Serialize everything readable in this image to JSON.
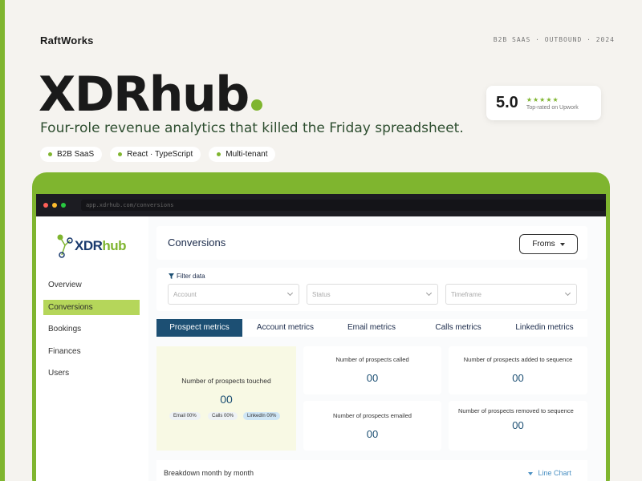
{
  "brand": "RaftWorks",
  "meta": "B2B SAAS · OUTBOUND · 2024",
  "hero": {
    "title": "XDRhub",
    "tagline": "Four-role revenue analytics that killed the Friday spreadsheet."
  },
  "chips": [
    "B2B SaaS",
    "React · TypeScript",
    "Multi-tenant"
  ],
  "rating": {
    "score": "5.0",
    "stars": "★★★★★",
    "label": "Top-rated on Upwork"
  },
  "colors": {
    "accent": "#7fb52f",
    "nav_active": "#b5d65a",
    "tab_active": "#1c4f73"
  },
  "window": {
    "url": "app.xdrhub.com/conversions"
  },
  "sidebar": {
    "logo": {
      "prefix": "XDR",
      "suffix": "hub"
    },
    "items": [
      {
        "label": "Overview",
        "active": false
      },
      {
        "label": "Conversions",
        "active": true
      },
      {
        "label": "Bookings",
        "active": false
      },
      {
        "label": "Finances",
        "active": false
      },
      {
        "label": "Users",
        "active": false
      }
    ]
  },
  "header": {
    "title": "Conversions",
    "dropdown": "Froms"
  },
  "filters": {
    "label": "Filter data",
    "selects": [
      {
        "placeholder": "Account"
      },
      {
        "placeholder": "Status"
      },
      {
        "placeholder": "Timeframe"
      }
    ]
  },
  "tabs": [
    {
      "label": "Prospect metrics",
      "active": true
    },
    {
      "label": "Account metrics",
      "active": false
    },
    {
      "label": "Email metrics",
      "active": false
    },
    {
      "label": "Calls metrics",
      "active": false
    },
    {
      "label": "Linkedin metrics",
      "active": false
    }
  ],
  "metrics": {
    "touched": {
      "label": "Number of prospects touched",
      "value": "00",
      "breakdown": [
        {
          "label": "Email 00%"
        },
        {
          "label": "Calls 00%"
        },
        {
          "label": "LinkedIn 00%"
        }
      ]
    },
    "called": {
      "label": "Number of prospects called",
      "value": "00"
    },
    "added": {
      "label": "Number of prospects added to sequence",
      "value": "00"
    },
    "emailed": {
      "label": "Number of prospects emailed",
      "value": "00"
    },
    "removed": {
      "label": "Number of prospects removed to sequence",
      "value": "00"
    }
  },
  "breakdown": {
    "label": "Breakdown month by month",
    "chart_type": "Line Chart"
  }
}
